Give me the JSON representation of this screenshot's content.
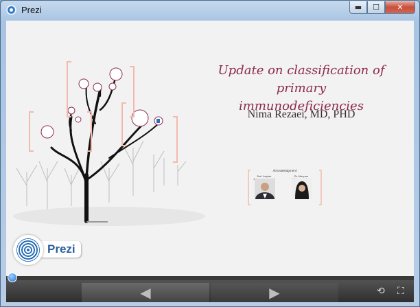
{
  "window": {
    "title": "Prezi",
    "min_label": "▬",
    "max_label": "☐",
    "close_label": "✕"
  },
  "presentation": {
    "title_line1": "Update on classification of primary",
    "title_line2": "immunodeficiencies",
    "author": "Nima Rezaei, MD, PHD",
    "ack_label": "Acknowledgment",
    "ack_person1": "Prof. Asghar Aghamohammadi",
    "ack_person2": "Dr. Maryam Mohammadian"
  },
  "logo": {
    "text": "Prezi"
  },
  "player": {
    "progress": 0.0,
    "prev_label": "◀",
    "next_label": "▶",
    "autoplay_label": "⟲",
    "fullscreen_label": "⛶"
  },
  "colors": {
    "title": "#8d2a4f",
    "bracket": "#f3b9ad",
    "accent": "#2b6fb8"
  }
}
